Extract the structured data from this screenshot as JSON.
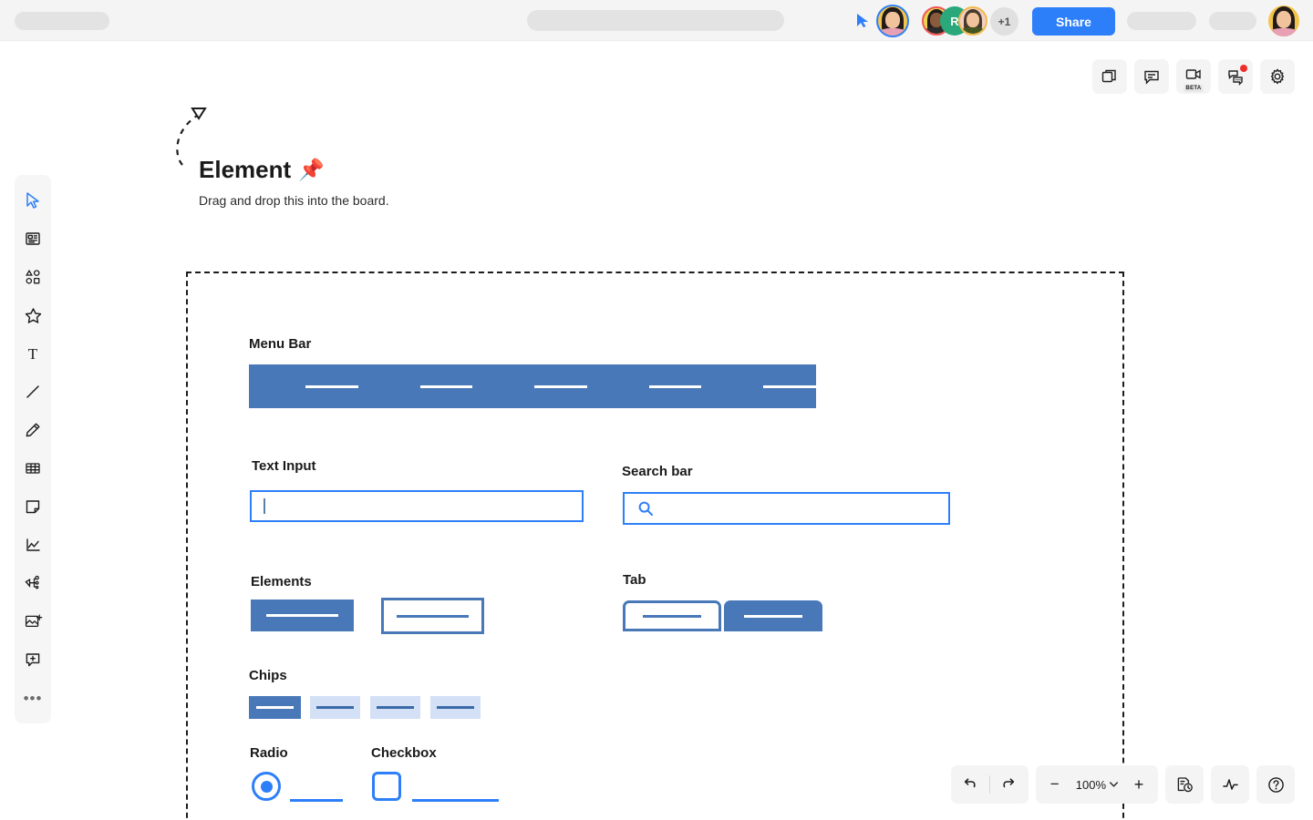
{
  "topbar": {
    "share_label": "Share",
    "overflow_count": "+1",
    "avatar_initial": "R",
    "icons": {
      "cursor": "pointer-cursor-icon"
    }
  },
  "top_right_toolbar": {
    "items": [
      {
        "name": "pages-icon",
        "label": ""
      },
      {
        "name": "comment-icon",
        "label": ""
      },
      {
        "name": "video-camera-icon",
        "label": "BETA"
      },
      {
        "name": "chat-icon",
        "label": ""
      },
      {
        "name": "gear-icon",
        "label": ""
      }
    ]
  },
  "left_toolbar": {
    "items": [
      {
        "name": "select-cursor-tool",
        "active": true
      },
      {
        "name": "template-tool",
        "active": false
      },
      {
        "name": "shapes-tool",
        "active": false
      },
      {
        "name": "sticker-star-tool",
        "active": false
      },
      {
        "name": "text-tool",
        "active": false
      },
      {
        "name": "line-tool",
        "active": false
      },
      {
        "name": "pen-tool",
        "active": false
      },
      {
        "name": "table-tool",
        "active": false
      },
      {
        "name": "sticky-note-tool",
        "active": false
      },
      {
        "name": "chart-tool",
        "active": false
      },
      {
        "name": "mindmap-tool",
        "active": false
      },
      {
        "name": "upload-image-tool",
        "active": false
      },
      {
        "name": "add-comment-tool",
        "active": false
      },
      {
        "name": "more-tools",
        "active": false
      }
    ],
    "more_glyph": "•••"
  },
  "canvas": {
    "element_title": "Element",
    "pin_emoji": "📌",
    "element_subtitle": "Drag and drop this into the board.",
    "sections": {
      "menu_bar": "Menu Bar",
      "text_input": "Text Input",
      "search_bar": "Search bar",
      "elements": "Elements",
      "tab": "Tab",
      "chips": "Chips",
      "radio": "Radio",
      "checkbox": "Checkbox"
    },
    "menu_bar_items": 5,
    "chips_count": 4
  },
  "bottom_toolbar": {
    "undo": "undo-icon",
    "redo": "redo-icon",
    "zoom_out": "−",
    "zoom_level": "100%",
    "zoom_in": "+",
    "history": "history-icon",
    "activity": "activity-icon",
    "help": "?"
  },
  "colors": {
    "accent_blue": "#2d7ff9",
    "mock_blue": "#4878b8",
    "chip_light": "#d3e0f5",
    "toolbar_gray": "#f4f4f4",
    "notification_red": "#f02d2d"
  }
}
